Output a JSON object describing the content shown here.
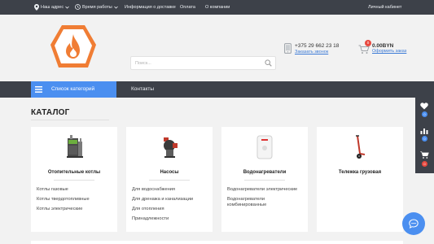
{
  "topbar": {
    "address": "Наш адрес",
    "hours": "Время работы",
    "delivery": "Информация о доставке",
    "payment": "Оплата",
    "about": "О компании",
    "account": "Личный кабинет"
  },
  "header": {
    "search_placeholder": "Поиск...",
    "phone": "+375 29 662 23 18",
    "callback": "Заказать звонок",
    "cart_count": "0",
    "cart_sum": "0.00BYN",
    "order_link": "Оформить заказ"
  },
  "nav": {
    "categories": "Список категорий",
    "contacts": "Контакты"
  },
  "catalog": {
    "title": "КАТАЛОГ",
    "cards": [
      {
        "title": "Отопительные котлы",
        "links": [
          "Котлы газовые",
          "Котлы твердотопливные",
          "Котлы электрические"
        ]
      },
      {
        "title": "Насосы",
        "links": [
          "Для водоснабжения",
          "Для дренажа и канализации",
          "Для отопления",
          "Принадлежности"
        ]
      },
      {
        "title": "Водонагреватели",
        "links": [
          "Водонагреватели электрические",
          "Водонагреватели комбинированные"
        ]
      },
      {
        "title": "Тележка грузовая",
        "links": []
      }
    ]
  },
  "side": {
    "favorites_count": "0",
    "compare_count": "0",
    "cart_count": "0"
  },
  "colors": {
    "dark": "#3d4149",
    "accent": "#4b8ff0",
    "logo": "#f07d34",
    "badge_red": "#e8493f"
  },
  "icons": [
    "map-pin-icon",
    "clock-icon",
    "search-icon",
    "phone-icon",
    "cart-icon",
    "burger-icon",
    "heart-icon",
    "chart-icon",
    "chat-icon"
  ]
}
